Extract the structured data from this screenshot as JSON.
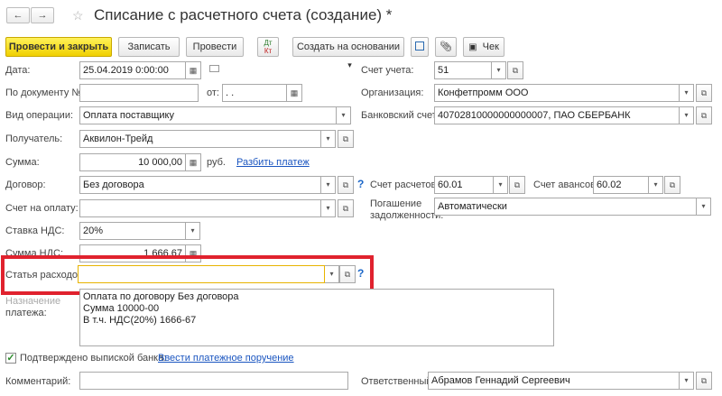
{
  "window": {
    "title": "Списание с расчетного счета (создание) *",
    "nav_back": "←",
    "nav_forward": "→"
  },
  "toolbar": {
    "post_close": "Провести и закрыть",
    "save": "Записать",
    "post": "Провести",
    "dtkt_top": "Дт",
    "dtkt_bottom": "Кт",
    "create_based": "Создать на основании",
    "create_based_arrow": "▾",
    "check": "Чек"
  },
  "form": {
    "date_label": "Дата:",
    "date_value": "25.04.2019  0:00:00",
    "docnum_label": "По документу №:",
    "docnum_value": "",
    "from_label": "от:",
    "from_value": " .  .",
    "optype_label": "Вид операции:",
    "optype_value": "Оплата поставщику",
    "recipient_label": "Получатель:",
    "recipient_value": "Аквилон-Трейд",
    "sum_label": "Сумма:",
    "sum_value": "10 000,00",
    "currency": "руб.",
    "split_payment": "Разбить платеж",
    "contract_label": "Договор:",
    "contract_value": "Без договора",
    "invoice_label": "Счет на оплату:",
    "invoice_value": "",
    "vat_rate_label": "Ставка НДС:",
    "vat_rate_value": "20%",
    "vat_sum_label": "Сумма НДС:",
    "vat_sum_value": "1 666,67",
    "expense_label": "Статья расходов:",
    "expense_value": "",
    "purpose_label_1": "Назначение",
    "purpose_label_2": "платежа:",
    "purpose_lines": [
      "Оплата по договору Без договора",
      "Сумма 10000-00",
      "В т.ч. НДС(20%) 1666-67"
    ],
    "confirmed_label": "Подтверждено выпиской банка:",
    "enter_order_link": "Ввести платежное поручение",
    "comment_label": "Комментарий:",
    "comment_value": "",
    "account_label": "Счет учета:",
    "account_value": "51",
    "org_label": "Организация:",
    "org_value": "Конфетпромм ООО",
    "bank_label": "Банковский счет:",
    "bank_value": "40702810000000000007, ПАО СБЕРБАНК",
    "settle_label": "Счет расчетов:",
    "settle_value": "60.01",
    "advance_label": "Счет авансов:",
    "advance_value": "60.02",
    "debt_label_1": "Погашение",
    "debt_label_2": "задолженности:",
    "debt_value": "Автоматически",
    "responsible_label": "Ответственный:",
    "responsible_value": "Абрамов Геннадий Сергеевич",
    "help_mark": "?"
  },
  "icons": {
    "dropdown": "▾",
    "open": "⧉",
    "calendar": "▦"
  },
  "colors": {
    "highlight": "#e0222e",
    "primary_button": "#f0d000",
    "link": "#1a55c0"
  }
}
